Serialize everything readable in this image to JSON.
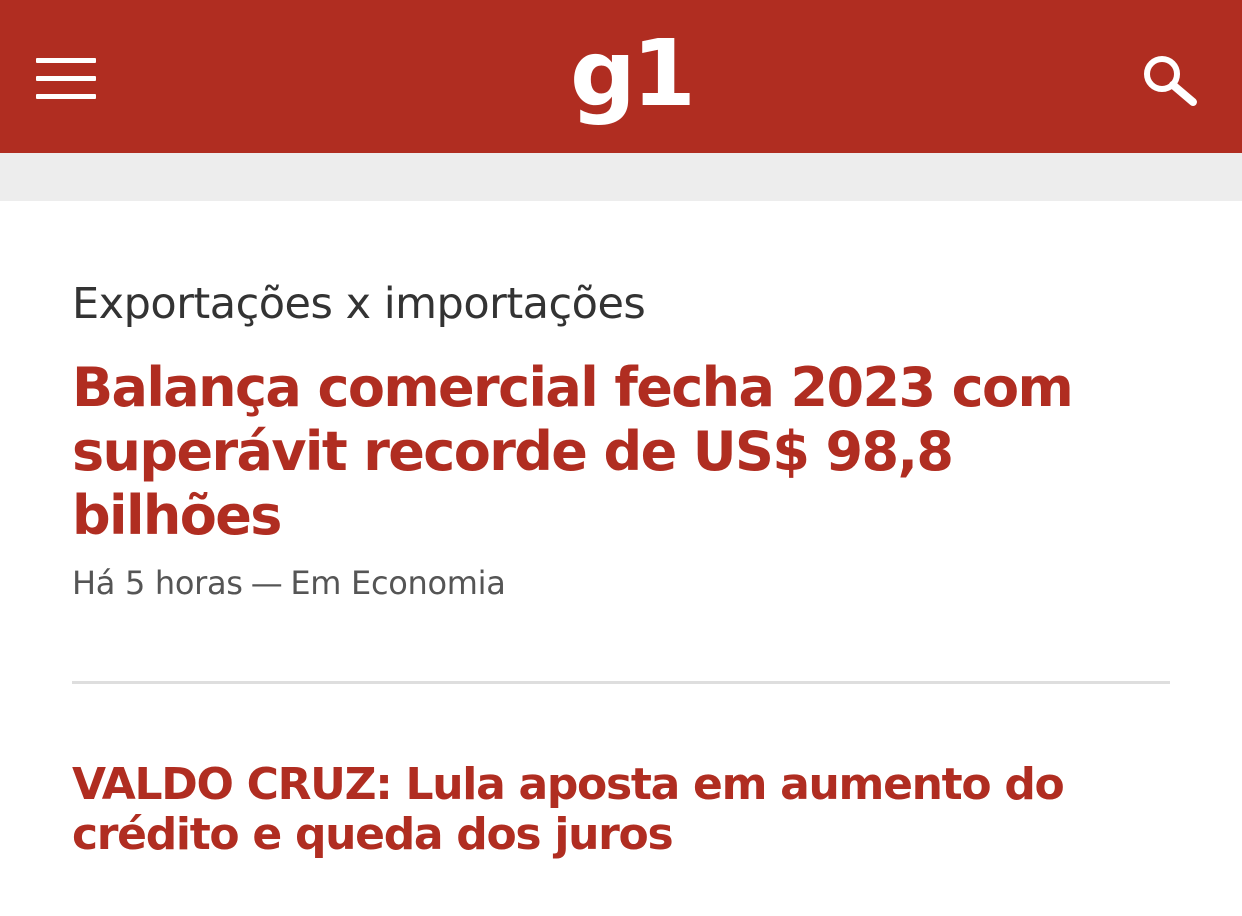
{
  "colors": {
    "brand_red": "#b02d21",
    "subbar_gray": "#ededed",
    "text_dark": "#333333",
    "text_meta": "#555555",
    "divider": "#dedede"
  },
  "header": {
    "menu_icon": "hamburger-menu-icon",
    "logo_text": "g1",
    "search_icon": "search-icon"
  },
  "feed": {
    "item1": {
      "kicker": "Exportações x importações",
      "headline": "Balança comercial fecha 2023 com superávit recorde de US$ 98,8 bilhões",
      "time": "Há 5 horas",
      "separator": "—",
      "section": "Em Economia"
    },
    "item2": {
      "headline": "VALDO CRUZ: Lula aposta em aumento do crédito e queda dos juros"
    }
  }
}
